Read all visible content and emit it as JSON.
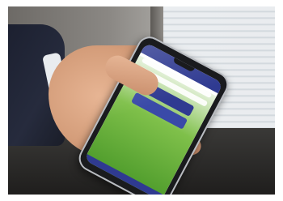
{
  "photo": {
    "description_kind": "hand holding smartphone"
  },
  "app": {
    "header_title": "",
    "brand_text": "",
    "user_name": "",
    "info_line1": "",
    "info_line2": "",
    "primary_button_label": "",
    "secondary_button_label": "",
    "bottom_bar_label": ""
  },
  "colors": {
    "app_primary": "#2f3a91",
    "brand_red": "#c0282d",
    "grass_green": "#4c9a2a"
  }
}
